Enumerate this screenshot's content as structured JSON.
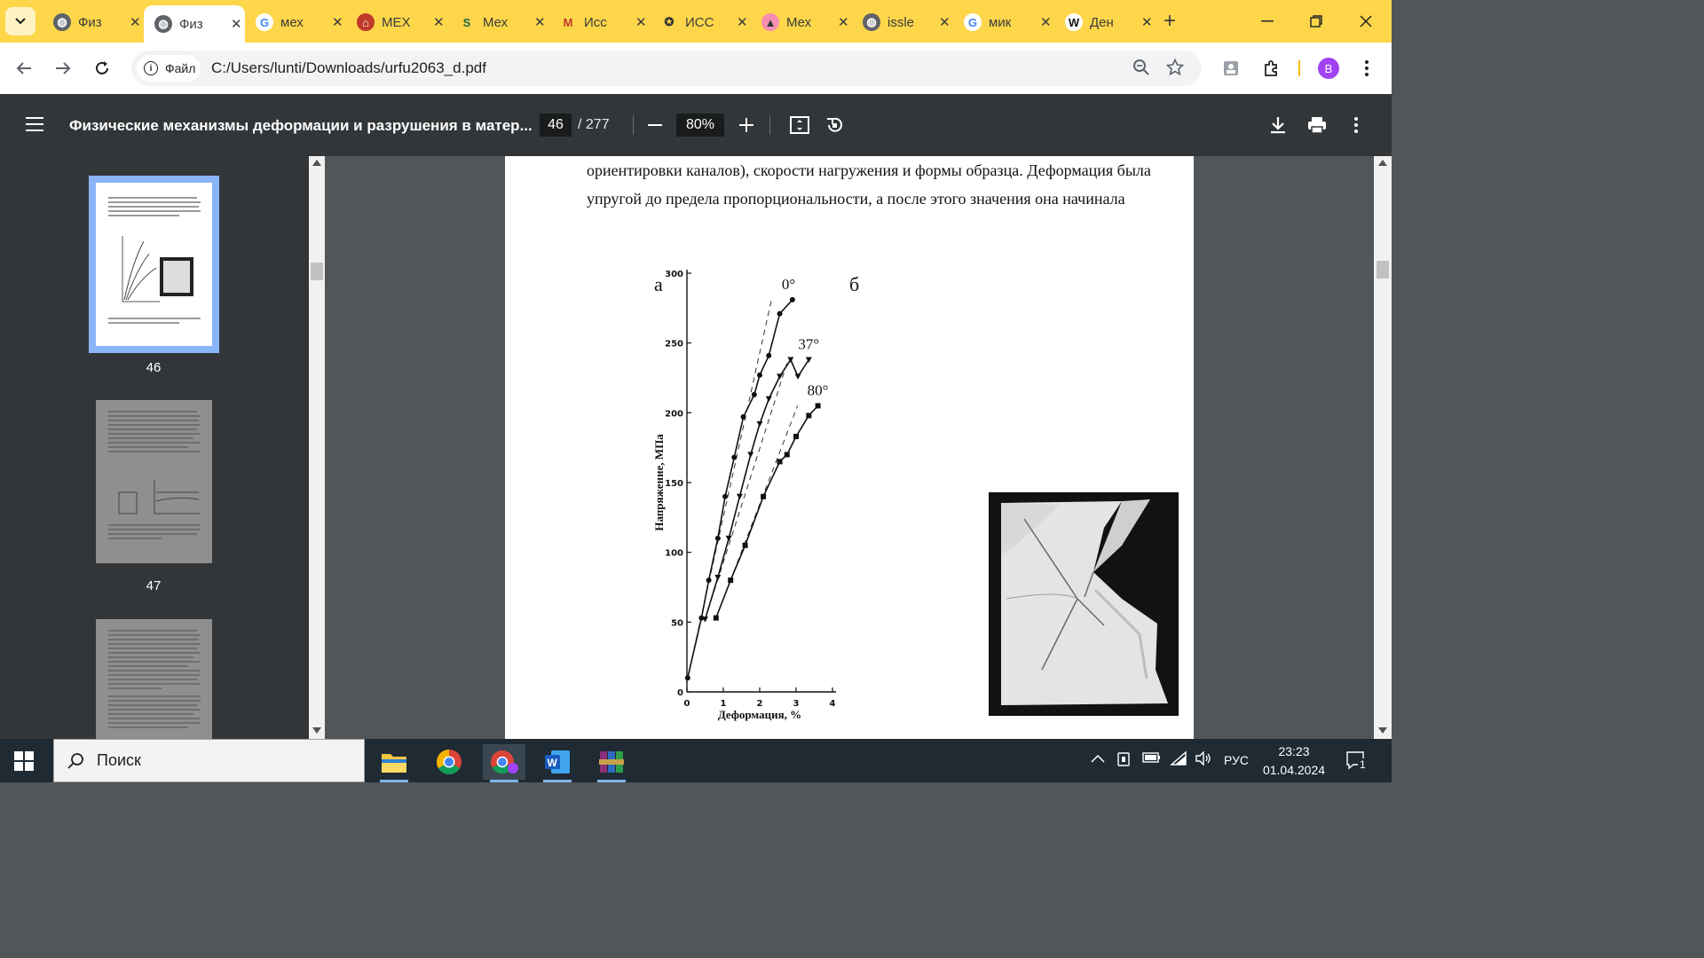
{
  "browser": {
    "tabs": [
      {
        "title": "Физ",
        "favicon": "globe-icon",
        "active": false
      },
      {
        "title": "Физ",
        "favicon": "globe-icon",
        "active": true
      },
      {
        "title": "мех",
        "favicon": "google-icon",
        "active": false
      },
      {
        "title": "МЕХ",
        "favicon": "building-icon",
        "active": false
      },
      {
        "title": "Мех",
        "favicon": "s-icon",
        "active": false
      },
      {
        "title": "Исс",
        "favicon": "mc-icon",
        "active": false
      },
      {
        "title": "ИСС",
        "favicon": "crest-icon",
        "active": false
      },
      {
        "title": "Мех",
        "favicon": "grad-cap-icon",
        "active": false
      },
      {
        "title": "issle",
        "favicon": "globe-icon",
        "active": false
      },
      {
        "title": "мик",
        "favicon": "google-icon",
        "active": false
      },
      {
        "title": "Ден",
        "favicon": "wikipedia-icon",
        "active": false
      }
    ],
    "new_tab": "+",
    "address": {
      "chip_label": "Файл",
      "url": "C:/Users/lunti/Downloads/urfu2063_d.pdf"
    },
    "profile_initial": "B"
  },
  "pdf_toolbar": {
    "title": "Физические механизмы деформации и разрушения в матер...",
    "current_page": "46",
    "total_pages": "/ 277",
    "zoom": "80%"
  },
  "thumbnails": [
    {
      "page": "46",
      "selected": true
    },
    {
      "page": "47",
      "selected": false
    }
  ],
  "page": {
    "lines": [
      "ориентировки каналов), скорости нагружения и формы образца. Деформация была",
      "упругой до предела пропорциональности, а после этого значения она начинала"
    ],
    "panel_a": "а",
    "panel_b": "б"
  },
  "chart_data": {
    "type": "line",
    "xlabel": "Деформация, %",
    "ylabel": "Напряжение, МПа",
    "xlim": [
      0,
      4
    ],
    "ylim": [
      0,
      300
    ],
    "xticks": [
      "0",
      "1",
      "2",
      "3",
      "4"
    ],
    "yticks": [
      "0",
      "50",
      "100",
      "150",
      "200",
      "250",
      "300"
    ],
    "series": [
      {
        "name": "0°",
        "marker": "circle",
        "x": [
          0.02,
          0.4,
          0.6,
          0.85,
          1.05,
          1.3,
          1.55,
          1.85,
          2.0,
          2.25,
          2.55,
          2.9
        ],
        "y": [
          10,
          53,
          80,
          110,
          140,
          168,
          197,
          213,
          227,
          241,
          271,
          281
        ]
      },
      {
        "name": "37°",
        "marker": "triangle",
        "x": [
          0.5,
          0.85,
          1.15,
          1.45,
          1.75,
          2.0,
          2.25,
          2.55,
          2.85,
          3.05,
          3.35
        ],
        "y": [
          52,
          82,
          110,
          140,
          170,
          192,
          210,
          226,
          238,
          226,
          238
        ]
      },
      {
        "name": "80°",
        "marker": "square",
        "x": [
          0.8,
          1.2,
          1.6,
          2.1,
          2.55,
          2.75,
          3.0,
          3.35,
          3.6
        ],
        "y": [
          53,
          80,
          105,
          140,
          165,
          170,
          183,
          198,
          205
        ]
      }
    ]
  },
  "taskbar": {
    "search_placeholder": "Поиск",
    "language": "РУС",
    "time": "23:23",
    "date": "01.04.2024",
    "notifications": "1"
  }
}
